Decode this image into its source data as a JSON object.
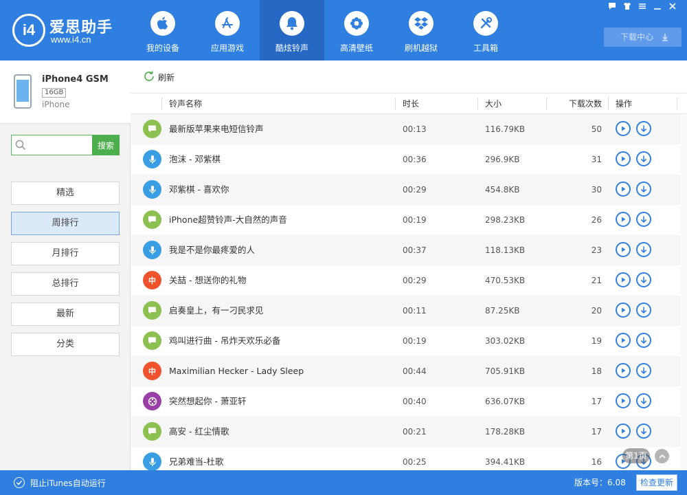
{
  "app": {
    "title": "爱思助手",
    "url": "www.i4.cn",
    "logo_text": "i4"
  },
  "nav": [
    {
      "label": "我的设备",
      "icon": "apple-icon"
    },
    {
      "label": "应用游戏",
      "icon": "app-store-icon"
    },
    {
      "label": "酷炫铃声",
      "icon": "bell-icon",
      "active": true
    },
    {
      "label": "高清壁纸",
      "icon": "flower-icon"
    },
    {
      "label": "刷机越狱",
      "icon": "dropbox-icon"
    },
    {
      "label": "工具箱",
      "icon": "tools-icon"
    }
  ],
  "window_controls": [
    "feedback-icon",
    "skin-icon",
    "menu-icon",
    "minimize-icon",
    "close-icon"
  ],
  "download_center": "下载中心",
  "device": {
    "name": "iPhone4 GSM",
    "capacity": "16GB",
    "model": "iPhone"
  },
  "search": {
    "placeholder": "",
    "button": "搜索"
  },
  "categories": [
    {
      "label": "精选"
    },
    {
      "label": "周排行",
      "active": true
    },
    {
      "label": "月排行"
    },
    {
      "label": "总排行"
    },
    {
      "label": "最新"
    },
    {
      "label": "分类"
    }
  ],
  "toolbar": {
    "refresh": "刷新"
  },
  "columns": {
    "name": "铃声名称",
    "duration": "时长",
    "size": "大小",
    "downloads": "下载次数",
    "actions": "操作"
  },
  "ringtones": [
    {
      "type": "message",
      "name": "最新版苹果来电短信铃声",
      "duration": "00:13",
      "size": "116.79KB",
      "downloads": "50"
    },
    {
      "type": "voice",
      "name": "泡沫 - 邓紫棋",
      "duration": "00:36",
      "size": "296.9KB",
      "downloads": "31"
    },
    {
      "type": "voice",
      "name": "邓紫棋 - 喜欢你",
      "duration": "00:29",
      "size": "454.8KB",
      "downloads": "30"
    },
    {
      "type": "message",
      "name": "iPhone超赞铃声-大自然的声音",
      "duration": "00:19",
      "size": "298.23KB",
      "downloads": "26"
    },
    {
      "type": "voice",
      "name": "我是不是你最疼爱的人",
      "duration": "00:37",
      "size": "118.13KB",
      "downloads": "23"
    },
    {
      "type": "china",
      "name": "关喆 - 想送你的礼物",
      "duration": "00:29",
      "size": "470.53KB",
      "downloads": "21"
    },
    {
      "type": "message",
      "name": "启奏皇上，有一刁民求见",
      "duration": "00:11",
      "size": "87.25KB",
      "downloads": "20"
    },
    {
      "type": "message",
      "name": "鸡叫进行曲 - 吊炸天欢乐必备",
      "duration": "00:19",
      "size": "303.02KB",
      "downloads": "19"
    },
    {
      "type": "china",
      "name": "Maximilian Hecker - Lady Sleep",
      "duration": "00:44",
      "size": "705.91KB",
      "downloads": "18"
    },
    {
      "type": "game",
      "name": "突然想起你 - 萧亚轩",
      "duration": "00:40",
      "size": "636.07KB",
      "downloads": "17"
    },
    {
      "type": "message",
      "name": "高安 - 红尘情歌",
      "duration": "00:21",
      "size": "178.28KB",
      "downloads": "17"
    },
    {
      "type": "voice",
      "name": "兄弟难当-杜歌",
      "duration": "00:25",
      "size": "394.41KB",
      "downloads": "16"
    }
  ],
  "type_colors": {
    "message": "#8cc152",
    "voice": "#3a9ee4",
    "china": "#f0522e",
    "game": "#9a3fa8"
  },
  "china_glyph": "中",
  "page_indicator": "第1页",
  "footer": {
    "itunes": "阻止iTunes自动运行",
    "version": "版本号：6.08",
    "update": "检查更新"
  },
  "colors": {
    "primary": "#2f7fe0",
    "accent_green": "#4cae4c"
  }
}
